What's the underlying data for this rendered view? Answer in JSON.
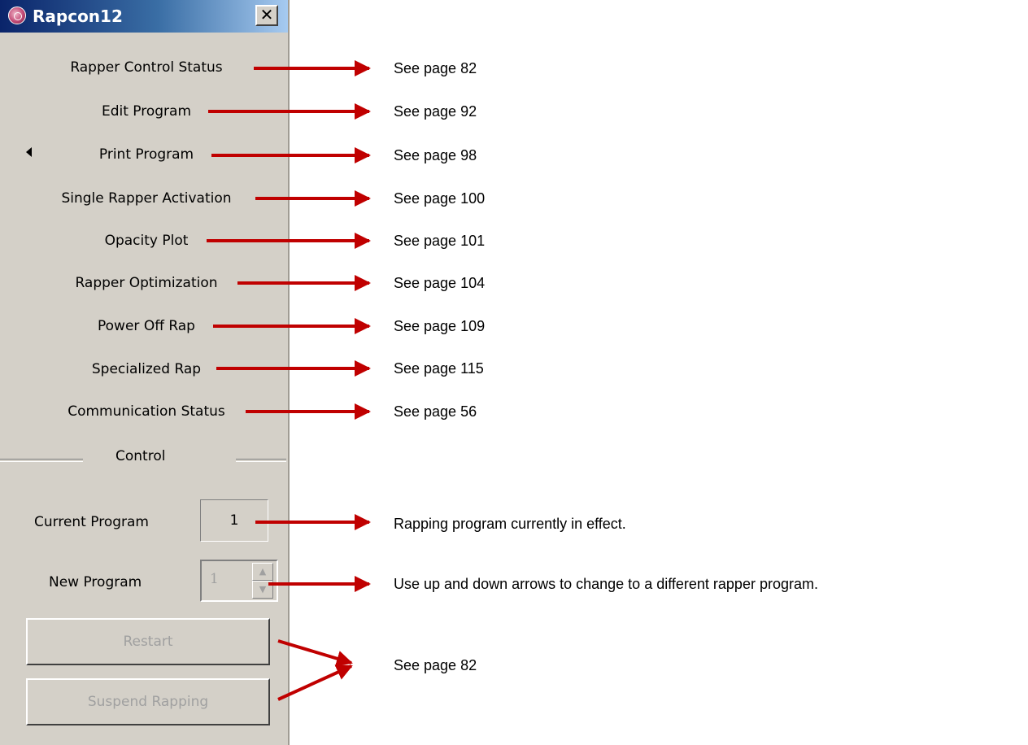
{
  "window": {
    "title": "Rapcon12",
    "close_glyph": "✕"
  },
  "menu": [
    {
      "label": "Rapper Control Status",
      "see": "See page 82"
    },
    {
      "label": "Edit Program",
      "see": "See page 92"
    },
    {
      "label": "Print Program",
      "see": "See page 98",
      "has_submenu": true
    },
    {
      "label": "Single Rapper Activation",
      "see": "See page 100"
    },
    {
      "label": "Opacity Plot",
      "see": "See page 101"
    },
    {
      "label": "Rapper Optimization",
      "see": "See page 104"
    },
    {
      "label": "Power Off Rap",
      "see": "See page 109"
    },
    {
      "label": "Specialized Rap",
      "see": "See page 115"
    },
    {
      "label": "Communication Status",
      "see": "See page 56"
    }
  ],
  "control": {
    "section_label": "Control",
    "current_program_label": "Current Program",
    "current_program_value": "1",
    "new_program_label": "New Program",
    "new_program_value": "1",
    "restart_label": "Restart",
    "suspend_label": "Suspend Rapping"
  },
  "notes": {
    "current_program": "Rapping program currently in effect.",
    "new_program": "Use up and down arrows to change to a different rapper program.",
    "buttons": "See page 82"
  },
  "colors": {
    "arrow": "#c00000",
    "panel": "#d4d0c8",
    "disabled_text": "#a0a0a0"
  },
  "icons": {
    "app": "rapcon-app-icon",
    "close": "close-icon",
    "submenu": "triangle-left-icon"
  }
}
